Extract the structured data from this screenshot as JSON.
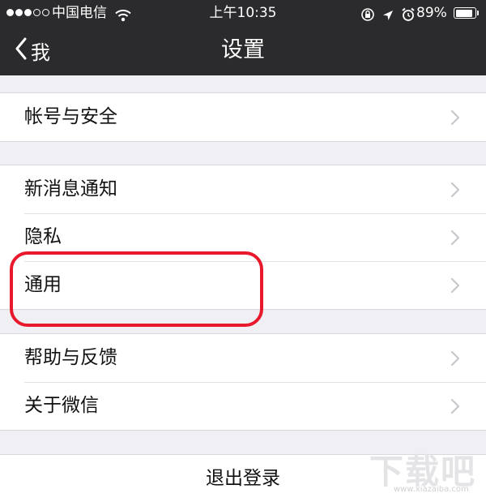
{
  "status_bar": {
    "carrier": "中国电信",
    "time": "上午10:35",
    "battery": "89%",
    "battery_level": 0.89,
    "icons": [
      "signal-dots-icon",
      "wifi-icon",
      "orientation-lock-icon",
      "location-icon",
      "alarm-icon",
      "battery-icon"
    ]
  },
  "nav": {
    "back_label": "我",
    "title": "设置"
  },
  "groups": [
    {
      "items": [
        {
          "label": "帐号与安全"
        }
      ]
    },
    {
      "items": [
        {
          "label": "新消息通知"
        },
        {
          "label": "隐私"
        },
        {
          "label": "通用"
        }
      ]
    },
    {
      "items": [
        {
          "label": "帮助与反馈"
        },
        {
          "label": "关于微信"
        }
      ]
    }
  ],
  "logout_label": "退出登录",
  "highlighted_item": "通用",
  "watermark": {
    "text": "下载吧",
    "url_text": "www.xiazaiba.com"
  },
  "colors": {
    "nav_background": "#2b2b2d",
    "page_background": "#efeff4",
    "highlight": "#e8192c",
    "chevron": "#c7c7cc"
  }
}
